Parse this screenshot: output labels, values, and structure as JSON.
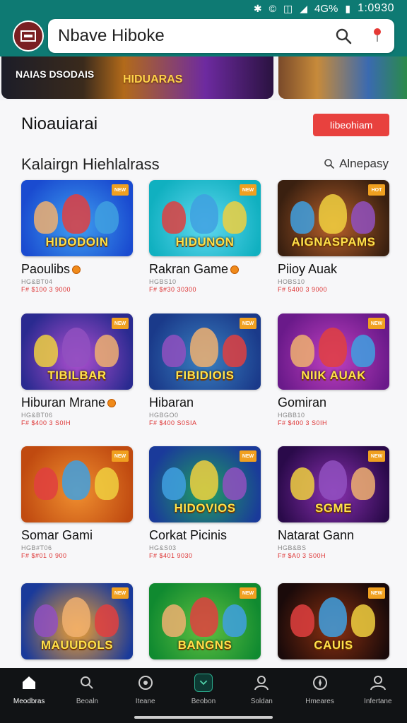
{
  "status_bar": {
    "time": "1:0930",
    "signal": "4G%",
    "icons": [
      "bluetooth-icon",
      "nfc-icon",
      "vibrate-icon",
      "signal-icon",
      "battery-icon"
    ]
  },
  "header": {
    "search_value": "Nbave Hiboke",
    "icons": [
      "app-logo",
      "search-icon",
      "location-pin-icon"
    ]
  },
  "banner": {
    "slide1_text": "NAIAS DSODAIS",
    "slide1_title": "HIDUARAS"
  },
  "section": {
    "title": "Nioauiarai",
    "button": "Iibeohiam"
  },
  "subsection": {
    "title": "Kalairgn Hiehlalrass",
    "filter": "Alnepasy"
  },
  "games": [
    {
      "name": "Paoulibs",
      "coin": true,
      "meta1": "HG&BT04",
      "meta2": "F# $100 3 9000",
      "thumb_title": "HIDODOIN",
      "tag": "NEW",
      "bg": [
        "#1a4bd0",
        "#3fa0f0"
      ]
    },
    {
      "name": "Rakran Game",
      "coin": true,
      "meta1": "HGBS10",
      "meta2": "F# $#30 30300",
      "thumb_title": "HIDUNON",
      "tag": "NEW",
      "bg": [
        "#10b0c0",
        "#60d8f0"
      ]
    },
    {
      "name": "Piioy Auak",
      "coin": false,
      "meta1": "HOBS10",
      "meta2": "F# 5400 3 9000",
      "thumb_title": "AIGNASPAMS",
      "tag": "HOT",
      "bg": [
        "#3a2010",
        "#b8602a"
      ]
    },
    {
      "name": "Hiburan Mrane",
      "coin": true,
      "meta1": "HG&BT06",
      "meta2": "F# $400 3 S0IH",
      "thumb_title": "TIBILBAR",
      "tag": "NEW",
      "bg": [
        "#2a2a90",
        "#b050d0"
      ]
    },
    {
      "name": "Hibaran",
      "coin": false,
      "meta1": "HGBGO0",
      "meta2": "F# $400 S0SIA",
      "thumb_title": "FIBIDIOIS",
      "tag": "NEW",
      "bg": [
        "#1a3a8a",
        "#3a80c0"
      ]
    },
    {
      "name": "Gomiran",
      "coin": false,
      "meta1": "HGBB10",
      "meta2": "F# $400 3 S0IH",
      "thumb_title": "NIIK AUAK",
      "tag": "NEW",
      "bg": [
        "#6a1a8a",
        "#c040c0"
      ]
    },
    {
      "name": "Somar Gami",
      "coin": false,
      "meta1": "HGB#T06",
      "meta2": "F# $#01 0 900",
      "thumb_title": "",
      "tag": "NEW",
      "bg": [
        "#c04a10",
        "#f09030"
      ]
    },
    {
      "name": "Corkat Picinis",
      "coin": false,
      "meta1": "HG&S03",
      "meta2": "F# $401 9030",
      "thumb_title": "HIDOVIOS",
      "tag": "NEW",
      "bg": [
        "#1a3a9a",
        "#20a060"
      ]
    },
    {
      "name": "Natarat Gann",
      "coin": false,
      "meta1": "HGB&BS",
      "meta2": "F# $A0 3 S00H",
      "thumb_title": "SGME",
      "tag": "NEW",
      "bg": [
        "#2a0a4a",
        "#8a30b0"
      ]
    },
    {
      "name": "",
      "coin": false,
      "meta1": "",
      "meta2": "",
      "thumb_title": "MAUUDOLS",
      "tag": "NEW",
      "bg": [
        "#1a3a9a",
        "#f0a030"
      ]
    },
    {
      "name": "",
      "coin": false,
      "meta1": "",
      "meta2": "",
      "thumb_title": "BANGNS",
      "tag": "NEW",
      "bg": [
        "#108a30",
        "#60c040"
      ]
    },
    {
      "name": "",
      "coin": false,
      "meta1": "",
      "meta2": "",
      "thumb_title": "CAUIS",
      "tag": "NEW",
      "bg": [
        "#1a0a0a",
        "#8a3010"
      ]
    }
  ],
  "nav": [
    {
      "label": "Meodbras",
      "icon": "home-icon"
    },
    {
      "label": "Beoaln",
      "icon": "search-icon"
    },
    {
      "label": "Iteane",
      "icon": "target-icon"
    },
    {
      "label": "Beobon",
      "icon": "game-icon"
    },
    {
      "label": "Soldan",
      "icon": "user-icon"
    },
    {
      "label": "Hmeares",
      "icon": "compass-icon"
    },
    {
      "label": "Infertane",
      "icon": "profile-icon"
    }
  ]
}
